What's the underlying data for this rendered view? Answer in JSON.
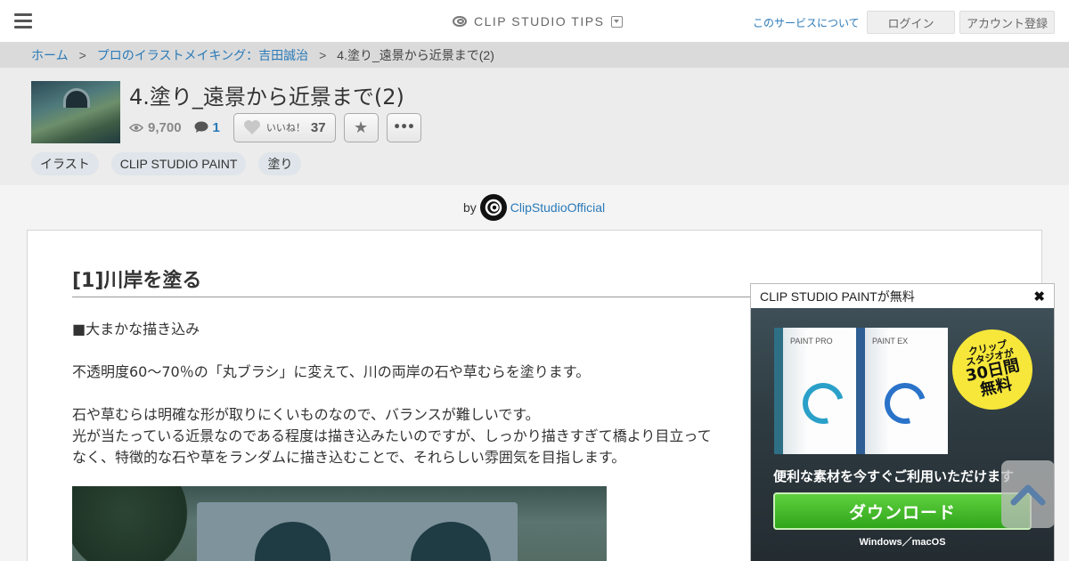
{
  "topbar": {
    "brand": "CLIP STUDIO TIPS",
    "about_link": "このサービスについて",
    "login_label": "ログイン",
    "register_label": "アカウント登録"
  },
  "breadcrumb": {
    "items": [
      "ホーム",
      "プロのイラストメイキング：吉田誠治",
      "4.塗り_遠景から近景まで(2)"
    ],
    "separator": ">"
  },
  "article": {
    "title": "4.塗り_遠景から近景まで(2)",
    "views": "9,700",
    "comments": "1",
    "like_label": "いいね！",
    "like_count": "37",
    "tags": [
      "イラスト",
      "CLIP STUDIO PAINT",
      "塗り"
    ],
    "by_label": "by",
    "author": "ClipStudioOfficial"
  },
  "content": {
    "heading": "[1]川岸を塗る",
    "paragraphs": [
      "■大まかな描き込み",
      "不透明度60～70％の「丸ブラシ」に変えて、川の両岸の石や草むらを塗ります。",
      "石や草むらは明確な形が取りにくいものなので、バランスが難しいです。",
      "光が当たっている近景なのである程度は描き込みたいのですが、しっかり描きすぎて橋より目立って",
      "なく、特徴的な石や草をランダムに描き込むことで、それらしい雰囲気を目指します。"
    ]
  },
  "ad": {
    "header": "CLIP STUDIO PAINTが無料",
    "box_pro_label": "PAINT PRO",
    "box_ex_label": "PAINT EX",
    "badge_line1": "クリップ",
    "badge_line2": "スタジオが",
    "badge_line3": "30日間",
    "badge_line4": "無料",
    "copy": "便利な素材を今すぐご利用いただけます",
    "download_label": "ダウンロード",
    "os_label": "Windows／macOS"
  },
  "colors": {
    "link": "#2a7ab8",
    "download_green": "#2fa51b",
    "badge_yellow": "#f6e73a"
  },
  "icons": {
    "menu": "hamburger-icon",
    "brand": "clip-studio-logo-icon",
    "views": "eye-icon",
    "comments": "comment-icon",
    "like": "heart-icon",
    "favorite": "star-icon",
    "more": "ellipsis-icon",
    "close": "close-icon",
    "to_top": "chevron-up-icon"
  }
}
